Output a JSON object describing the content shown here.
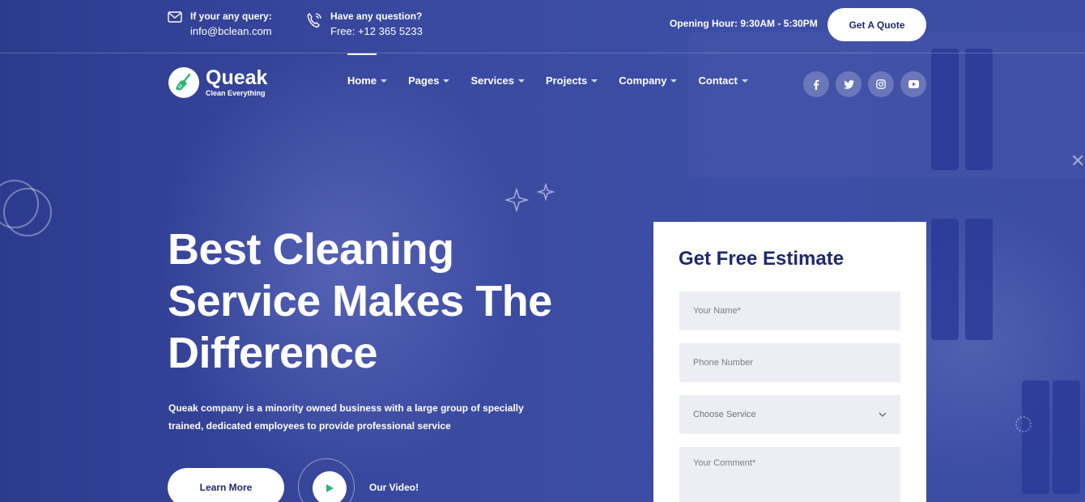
{
  "topbar": {
    "email": {
      "label": "If your any query:",
      "value": "info@bclean.com",
      "icon": "mail-icon"
    },
    "phone": {
      "label": "Have any question?",
      "value": "Free: +12 365 5233",
      "icon": "phone-icon"
    },
    "hours": "Opening Hour: 9:30AM - 5:30PM",
    "quote_button": "Get A Quote"
  },
  "brand": {
    "name": "Queak",
    "tagline": "Clean Everything",
    "icon": "broom-icon"
  },
  "nav": {
    "items": [
      {
        "label": "Home"
      },
      {
        "label": "Pages"
      },
      {
        "label": "Services"
      },
      {
        "label": "Projects"
      },
      {
        "label": "Company"
      },
      {
        "label": "Contact"
      }
    ],
    "active": "Home"
  },
  "socials": [
    {
      "name": "facebook-icon",
      "glyph": "f"
    },
    {
      "name": "twitter-icon",
      "glyph": "t"
    },
    {
      "name": "instagram-icon",
      "glyph": "◎"
    },
    {
      "name": "youtube-icon",
      "glyph": "▶"
    }
  ],
  "hero": {
    "headline_line1": "Best Cleaning",
    "headline_line2": "Service Makes The",
    "headline_line3": "Difference",
    "subtext_line1": "Queak company is a minority owned business with a large group of specially",
    "subtext_line2": "trained, dedicated employees to provide professional service",
    "learn_more": "Learn More",
    "video_label": "Our Video!"
  },
  "form": {
    "title": "Get Free Estimate",
    "name_placeholder": "Your Name*",
    "phone_placeholder": "Phone Number",
    "service_selected": "Choose Service",
    "comment_placeholder": "Your Comment*"
  },
  "colors": {
    "primary": "#3b4ba3",
    "dark_blue": "#1e2a6e",
    "accent_green": "#2bb673",
    "field_bg": "#eceef3"
  }
}
